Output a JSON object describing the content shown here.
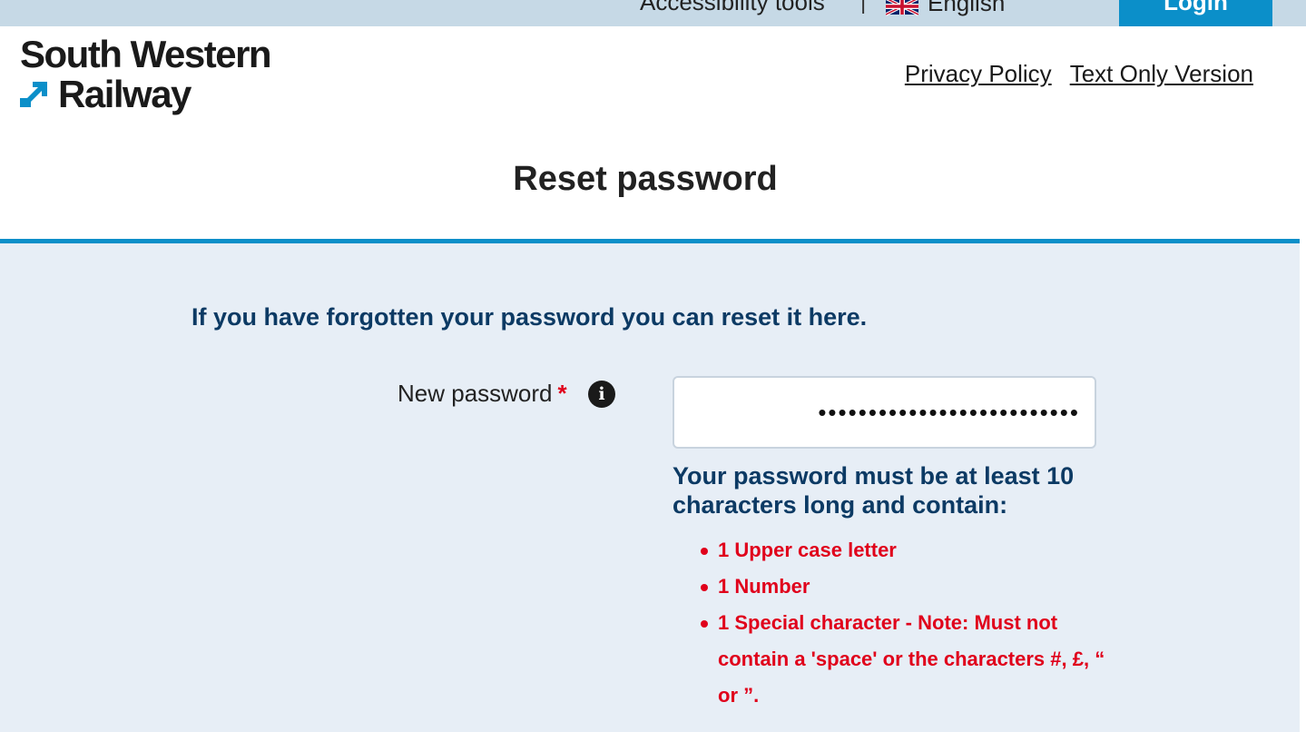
{
  "topbar": {
    "accessibility_label": "Accessibility tools",
    "separator": "|",
    "language_label": "English",
    "login_label": "Login"
  },
  "logo": {
    "line1": "South Western",
    "line2": "Railway",
    "mark_color": "#0b8fc9"
  },
  "header_links": {
    "privacy": "Privacy Policy",
    "text_only": "Text Only Version"
  },
  "page_title": "Reset password",
  "form": {
    "intro": "If you have forgotten your password you can reset it here.",
    "new_password_label": "New password",
    "required_mark": "*",
    "info_icon_glyph": "i",
    "password_value": "••••••••••••••••••••••••••",
    "rules_heading": "Your password must be at least 10 characters long and contain:",
    "rules": [
      "1 Upper case letter",
      "1 Number",
      "1 Special character - Note: Must not contain a 'space' or the characters #, £, “ or ”."
    ]
  },
  "colors": {
    "topbar_bg": "#c6d9e6",
    "accent_blue": "#0b8fc9",
    "panel_bg": "#e7eef6",
    "heading_navy": "#0c3a64",
    "error_red": "#e0001b"
  },
  "icons": {
    "flag": "uk-flag-icon",
    "info": "info-icon",
    "logo_mark": "swr-arrow-logo-icon"
  }
}
